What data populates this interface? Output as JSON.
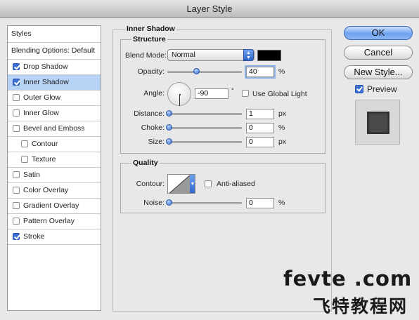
{
  "window": {
    "title": "Layer Style"
  },
  "styles_panel": {
    "header": "Styles",
    "blending": "Blending Options: Default",
    "items": [
      {
        "label": "Drop Shadow",
        "checked": true,
        "selected": false,
        "indent": false
      },
      {
        "label": "Inner Shadow",
        "checked": true,
        "selected": true,
        "indent": false
      },
      {
        "label": "Outer Glow",
        "checked": false,
        "selected": false,
        "indent": false
      },
      {
        "label": "Inner Glow",
        "checked": false,
        "selected": false,
        "indent": false
      },
      {
        "label": "Bevel and Emboss",
        "checked": false,
        "selected": false,
        "indent": false
      },
      {
        "label": "Contour",
        "checked": false,
        "selected": false,
        "indent": true
      },
      {
        "label": "Texture",
        "checked": false,
        "selected": false,
        "indent": true
      },
      {
        "label": "Satin",
        "checked": false,
        "selected": false,
        "indent": false
      },
      {
        "label": "Color Overlay",
        "checked": false,
        "selected": false,
        "indent": false
      },
      {
        "label": "Gradient Overlay",
        "checked": false,
        "selected": false,
        "indent": false
      },
      {
        "label": "Pattern Overlay",
        "checked": false,
        "selected": false,
        "indent": false
      },
      {
        "label": "Stroke",
        "checked": true,
        "selected": false,
        "indent": false
      }
    ]
  },
  "inner_shadow": {
    "title": "Inner Shadow",
    "structure": {
      "title": "Structure",
      "blend_mode_label": "Blend Mode:",
      "blend_mode_value": "Normal",
      "shadow_color": "#000000",
      "opacity_label": "Opacity:",
      "opacity_value": "40",
      "opacity_unit": "%",
      "opacity_level": 0.4,
      "angle_label": "Angle:",
      "angle_value": "-90",
      "angle_unit": "°",
      "global_light_label": "Use Global Light",
      "global_light_checked": false,
      "distance_label": "Distance:",
      "distance_value": "1",
      "distance_unit": "px",
      "choke_label": "Choke:",
      "choke_value": "0",
      "choke_unit": "%",
      "size_label": "Size:",
      "size_value": "0",
      "size_unit": "px"
    },
    "quality": {
      "title": "Quality",
      "contour_label": "Contour:",
      "antialiased_label": "Anti-aliased",
      "antialiased_checked": false,
      "noise_label": "Noise:",
      "noise_value": "0",
      "noise_unit": "%"
    }
  },
  "buttons": {
    "ok": "OK",
    "cancel": "Cancel",
    "new_style": "New Style..."
  },
  "preview": {
    "label": "Preview",
    "checked": true
  },
  "watermark": {
    "line1": "fevte .com",
    "line2": "飞特教程网"
  },
  "colors": {
    "accent": "#3b6fd4",
    "selection": "#b7d3f5"
  }
}
